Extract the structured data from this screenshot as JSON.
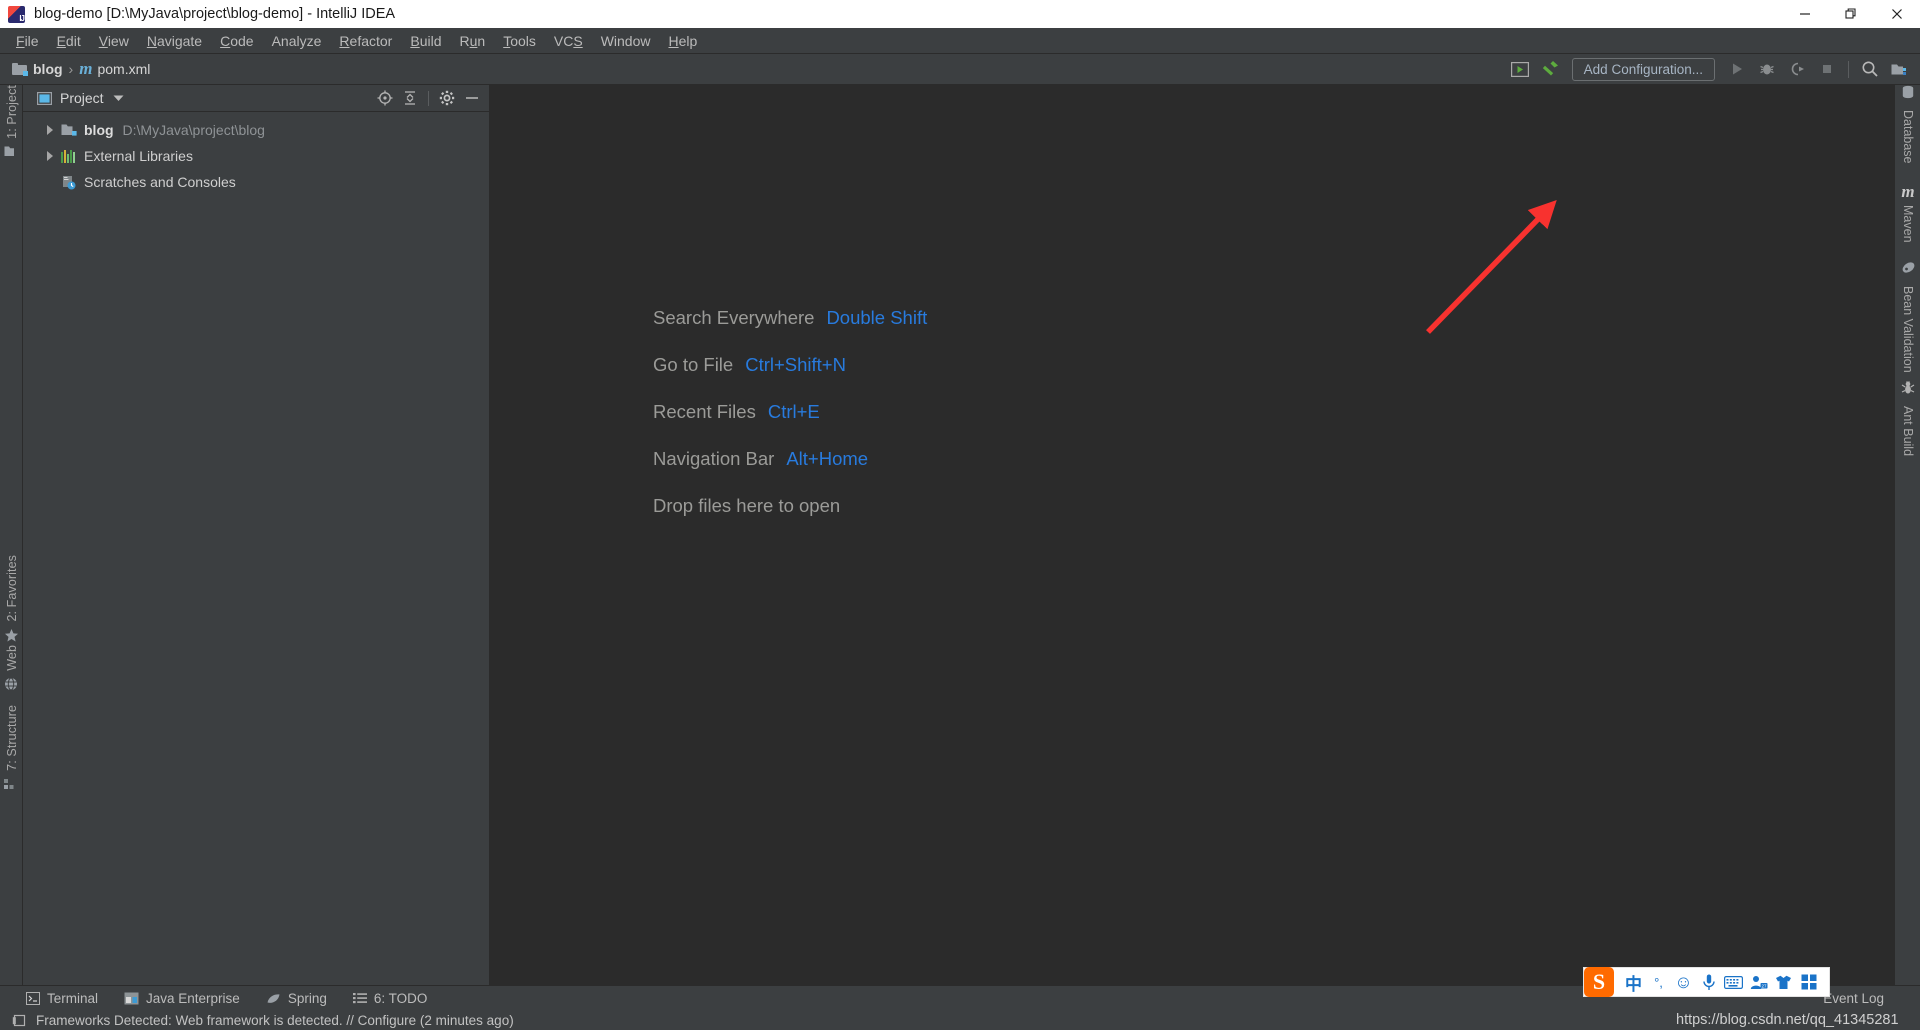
{
  "window": {
    "title": "blog-demo [D:\\MyJava\\project\\blog-demo] - IntelliJ IDEA",
    "app_icon": "intellij-idea-icon",
    "controls": {
      "minimize": "minimize-icon",
      "maximize": "restore-icon",
      "close": "close-icon"
    }
  },
  "menubar": {
    "items": [
      {
        "label": "File",
        "mnemonic": "F"
      },
      {
        "label": "Edit",
        "mnemonic": "E"
      },
      {
        "label": "View",
        "mnemonic": "V"
      },
      {
        "label": "Navigate",
        "mnemonic": "N"
      },
      {
        "label": "Code",
        "mnemonic": "C"
      },
      {
        "label": "Analyze",
        "mnemonic": "A"
      },
      {
        "label": "Refactor",
        "mnemonic": "R"
      },
      {
        "label": "Build",
        "mnemonic": "B"
      },
      {
        "label": "Run",
        "mnemonic": "R"
      },
      {
        "label": "Tools",
        "mnemonic": "T"
      },
      {
        "label": "VCS",
        "mnemonic": "S"
      },
      {
        "label": "Window",
        "mnemonic": "W"
      },
      {
        "label": "Help",
        "mnemonic": "H"
      }
    ]
  },
  "navbar": {
    "breadcrumb": [
      {
        "label": "blog",
        "icon": "module-folder-icon",
        "bold": true
      },
      {
        "label": "pom.xml",
        "icon": "maven-pom-icon",
        "bold": false
      }
    ],
    "separator": "›",
    "run_configuration": "Add Configuration...",
    "icons": {
      "update_project": "update-running-application-icon",
      "build": "build-hammer-icon",
      "run": "run-icon",
      "debug": "debug-bug-icon",
      "run_coverage": "run-with-coverage-icon",
      "stop": "stop-icon",
      "search": "search-everywhere-icon",
      "project_structure": "project-structure-icon"
    }
  },
  "left_strip": {
    "tabs": [
      {
        "label": "1: Project",
        "icon": "project-icon"
      },
      {
        "label": "2: Favorites",
        "icon": "star-icon"
      },
      {
        "label": "Web",
        "icon": "web-globe-icon"
      },
      {
        "label": "7: Structure",
        "icon": "structure-icon"
      }
    ]
  },
  "project_panel": {
    "title": "Project",
    "title_icon": "project-view-icon",
    "dropdown_icon": "chevron-down-icon",
    "actions": [
      {
        "name": "scroll-from-source-icon"
      },
      {
        "name": "collapse-all-icon"
      },
      {
        "name": "settings-gear-icon"
      },
      {
        "name": "hide-panel-icon"
      }
    ],
    "tree": [
      {
        "label": "blog",
        "path": "D:\\MyJava\\project\\blog",
        "icon": "module-folder-icon",
        "expandable": true,
        "bold": true
      },
      {
        "label": "External Libraries",
        "path": "",
        "icon": "external-libraries-icon",
        "expandable": true,
        "bold": false
      },
      {
        "label": "Scratches and Consoles",
        "path": "",
        "icon": "scratches-icon",
        "expandable": false,
        "bold": false
      }
    ]
  },
  "editor": {
    "tips": [
      {
        "label": "Search Everywhere",
        "shortcut": "Double Shift"
      },
      {
        "label": "Go to File",
        "shortcut": "Ctrl+Shift+N"
      },
      {
        "label": "Recent Files",
        "shortcut": "Ctrl+E"
      },
      {
        "label": "Navigation Bar",
        "shortcut": "Alt+Home"
      },
      {
        "label": "Drop files here to open",
        "shortcut": ""
      }
    ],
    "annotation": {
      "name": "red-arrow-annotation",
      "color": "#f8322f",
      "points_to": "Maven"
    }
  },
  "right_strip": {
    "tabs": [
      {
        "label": "Database",
        "icon": "database-icon"
      },
      {
        "label": "Maven",
        "icon": "maven-icon"
      },
      {
        "label": "Bean Validation",
        "icon": "bean-validation-icon"
      },
      {
        "label": "Ant Build",
        "icon": "ant-build-icon"
      }
    ]
  },
  "bottom_strip": {
    "tabs": [
      {
        "label": "Terminal",
        "icon": "terminal-icon",
        "mnemonic": ""
      },
      {
        "label": "Java Enterprise",
        "icon": "java-enterprise-icon",
        "mnemonic": ""
      },
      {
        "label": "Spring",
        "icon": "spring-leaf-icon",
        "mnemonic": ""
      },
      {
        "label": "6: TODO",
        "icon": "todo-list-icon",
        "mnemonic": "6"
      }
    ],
    "right_tabs": [
      {
        "label": "Event Log",
        "icon": "event-log-icon"
      }
    ]
  },
  "statusbar": {
    "icon": "frameworks-detected-icon",
    "message": "Frameworks Detected: Web framework is detected. // Configure (2 minutes ago)"
  },
  "ime_toolbar": {
    "logo": "sogou-input-logo",
    "buttons": [
      {
        "name": "language-mode-chinese",
        "glyph": "中"
      },
      {
        "name": "punctuation-mode",
        "glyph": "°,"
      },
      {
        "name": "emoji-picker",
        "glyph": "☺"
      },
      {
        "name": "voice-input",
        "glyph": "⬤"
      },
      {
        "name": "soft-keyboard",
        "glyph": "⌨"
      },
      {
        "name": "user-center",
        "glyph": "⛹"
      },
      {
        "name": "skin-selector",
        "glyph": "▼"
      },
      {
        "name": "toolbox-menu",
        "glyph": "▦"
      }
    ]
  },
  "watermark": {
    "text": "https://blog.csdn.net/qq_41345281"
  },
  "colors": {
    "background": "#3c3f41",
    "editor_background": "#2b2b2b",
    "accent_blue": "#287bde",
    "text_primary": "#cfcfcf",
    "text_secondary": "#9b9b98",
    "annotation_red": "#f8322f"
  }
}
